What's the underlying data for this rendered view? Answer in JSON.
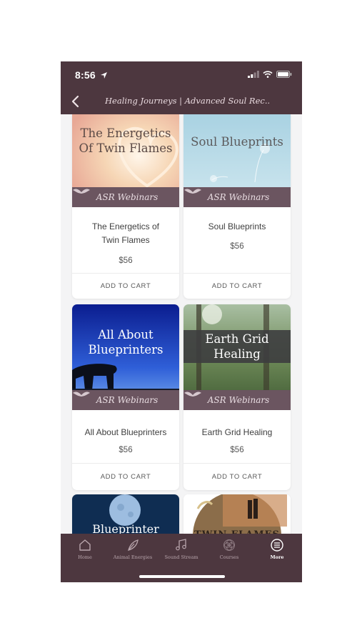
{
  "status": {
    "time": "8:56"
  },
  "nav": {
    "title": "Healing Journeys | Advanced Soul Rec..."
  },
  "webinar_brand": "ASR Webinars",
  "products": [
    {
      "image_title_1": "The Energetics",
      "image_title_2": "Of Twin Flames",
      "name_1": "The Energetics of",
      "name_2": "Twin Flames",
      "price": "$56",
      "cta": "ADD TO CART"
    },
    {
      "image_title_1": "Soul Blueprints",
      "image_title_2": "",
      "name_1": "Soul Blueprints",
      "name_2": "",
      "price": "$56",
      "cta": "ADD TO CART"
    },
    {
      "image_title_1": "All About",
      "image_title_2": "Blueprinters",
      "name_1": "All About Blueprinters",
      "name_2": "",
      "price": "$56",
      "cta": "ADD TO CART"
    },
    {
      "image_title_1": "Earth Grid",
      "image_title_2": "Healing",
      "name_1": "Earth Grid Healing",
      "name_2": "",
      "price": "$56",
      "cta": "ADD TO CART"
    },
    {
      "image_title_1": "Blueprinter"
    },
    {
      "image_title_1": "TWIN FLAMES"
    }
  ],
  "tabs": [
    {
      "label": "Home",
      "icon": "home-icon"
    },
    {
      "label": "Animal Energies",
      "icon": "feather-icon"
    },
    {
      "label": "Sound Stream",
      "icon": "music-note-icon"
    },
    {
      "label": "Courses",
      "icon": "mandala-icon"
    },
    {
      "label": "More",
      "icon": "more-icon"
    }
  ],
  "colors": {
    "header": "#4d373f",
    "band": "#6b5560",
    "background": "#f4f4f5"
  }
}
